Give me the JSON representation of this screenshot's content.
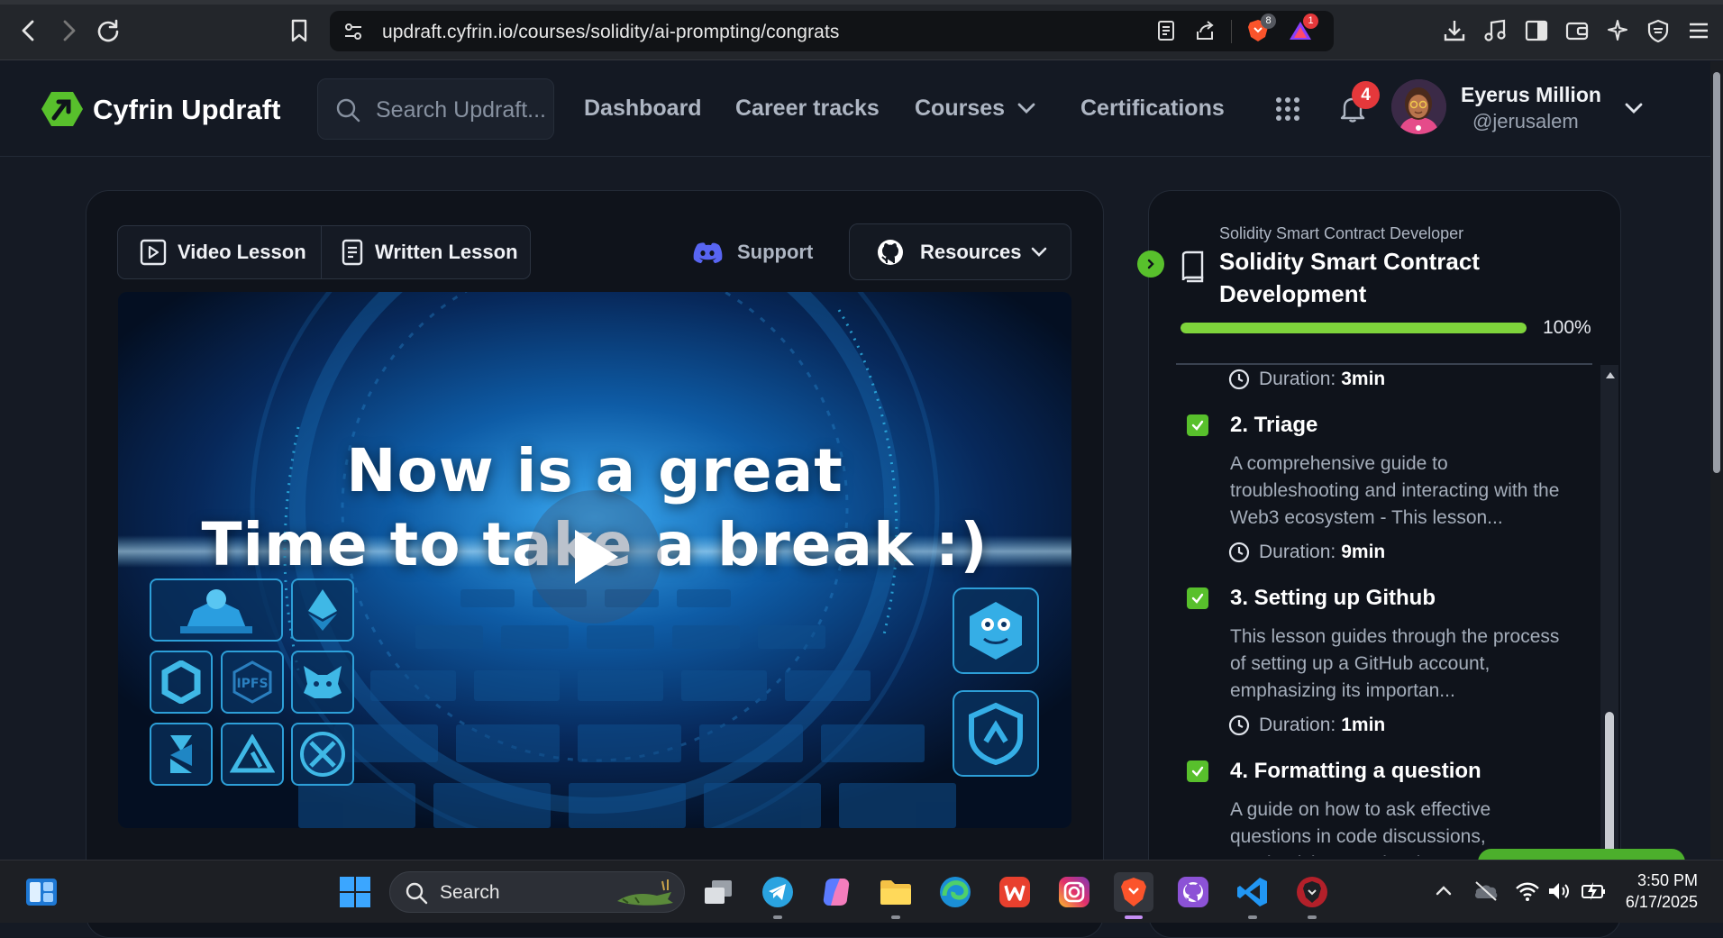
{
  "browser": {
    "url": "updraft.cyfrin.io/courses/solidity/ai-prompting/congrats",
    "brave_badge": "8",
    "rewards_badge": "1"
  },
  "header": {
    "logo_text": "Cyfrin Updraft",
    "search_placeholder": "Search Updraft...",
    "nav": [
      "Dashboard",
      "Career tracks",
      "Courses",
      "Certifications"
    ],
    "notifications_count": "4",
    "user_name": "Eyerus Million",
    "user_handle": "@jerusalem"
  },
  "lesson_controls": {
    "video_tab": "Video Lesson",
    "written_tab": "Written Lesson",
    "support": "Support",
    "resources": "Resources"
  },
  "video": {
    "headline_line1": "Now is a great",
    "headline_line2": "Time to take a break :)",
    "tile_ipfs": "IPFS"
  },
  "sidebar": {
    "track": "Solidity Smart Contract Developer",
    "course": "Solidity Smart Contract Development",
    "progress_label": "100%",
    "progress_value": 1.0,
    "duration_prefix": "Duration:",
    "first_duration": "3min",
    "lessons": [
      {
        "title": "2. Triage",
        "description": "A comprehensive guide to troubleshooting and interacting with the Web3 ecosystem - This lesson...",
        "duration": "9min"
      },
      {
        "title": "3. Setting up Github",
        "description": "This lesson guides through the process of setting up a GitHub account, emphasizing its importan...",
        "duration": "1min"
      },
      {
        "title": "4. Formatting a question",
        "description": "A guide on how to ask effective questions in code discussions, emphasizing on GitHub's...",
        "duration": ""
      }
    ]
  },
  "taskbar": {
    "search_label": "Search",
    "time": "3:50 PM",
    "date": "6/17/2025"
  },
  "colors": {
    "accent_green": "#58c02c",
    "progress_green": "#7ed43b",
    "notification_red": "#e5383b",
    "discord_purple": "#5865f2"
  }
}
